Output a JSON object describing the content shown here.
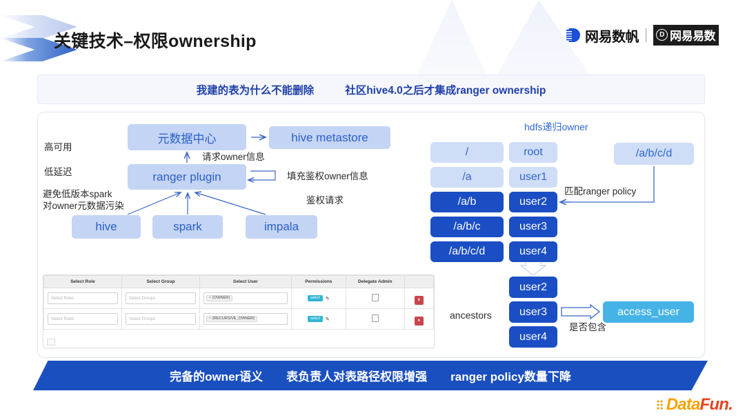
{
  "header": {
    "title": "关键技术–权限ownership",
    "brand_primary": "网易数帆",
    "brand_secondary": "网易易数",
    "brand_secondary_mark": "D",
    "chevron_icon": "chevron-decoration-icon"
  },
  "top_banner": {
    "items": [
      "我建的表为什么不能删除",
      "社区hive4.0之后才集成ranger ownership"
    ]
  },
  "diagram": {
    "left": {
      "qualities": [
        "高可用",
        "低延迟"
      ],
      "note_line1": "避免低版本spark",
      "note_line2": "对owner元数据污染",
      "nodes": {
        "metadata_center": "元数据中心",
        "hive_metastore": "hive metastore",
        "ranger_plugin": "ranger plugin",
        "hive": "hive",
        "spark": "spark",
        "impala": "impala"
      },
      "edge_labels": {
        "request_owner_info": "请求owner信息",
        "fill_auth_owner_info": "填充鉴权owner信息",
        "auth_request": "鉴权请求"
      }
    },
    "right": {
      "section_title": "hdfs递归owner",
      "paths": [
        {
          "path": "/",
          "owner": "root",
          "highlight": false
        },
        {
          "path": "/a",
          "owner": "user1",
          "highlight": false
        },
        {
          "path": "/a/b",
          "owner": "user2",
          "highlight": true
        },
        {
          "path": "/a/b/c",
          "owner": "user3",
          "highlight": true
        },
        {
          "path": "/a/b/c/d",
          "owner": "user4",
          "highlight": true
        }
      ],
      "policy_box": "/a/b/c/d",
      "policy_label": "匹配ranger policy",
      "ancestors_label": "ancestors",
      "ancestors": [
        "user2",
        "user3",
        "user4"
      ],
      "access_user": "access_user",
      "contains_label": "是否包含"
    }
  },
  "ranger_table": {
    "columns": [
      "Select Role",
      "Select Group",
      "Select User",
      "Permissions",
      "Delegate Admin",
      ""
    ],
    "rows": [
      {
        "role_placeholder": "Select Roles",
        "group_placeholder": "Select Groups",
        "user_tag": "{OWNER}",
        "tag_remove": "×",
        "permission": "select",
        "edit_icon": "pencil-icon",
        "delegate_admin": false,
        "delete_label": "x"
      },
      {
        "role_placeholder": "Select Roles",
        "group_placeholder": "Select Groups",
        "user_tag": "{RECURSIVE_OWNER}",
        "tag_remove": "×",
        "permission": "select",
        "edit_icon": "pencil-icon",
        "delegate_admin": false,
        "delete_label": "x"
      }
    ]
  },
  "bottom_banner": {
    "items": [
      "完备的owner语义",
      "表负责人对表路径权限增强",
      "ranger policy数量下降"
    ]
  },
  "watermark": {
    "text_a": "Data",
    "text_b": "Fun."
  },
  "colors": {
    "accent_blue": "#1a4fc0",
    "deep_box": "#1b4ec4",
    "pale_box": "#cfddf7",
    "light_box": "#c4d4f4",
    "cyan_box": "#45b3e6",
    "banner_bg": "#f5f7fd",
    "title_text": "#1f3fa8",
    "delete_red": "#c9444c",
    "datafun_orange": "#f5a200",
    "datafun_red": "#e8441f"
  }
}
